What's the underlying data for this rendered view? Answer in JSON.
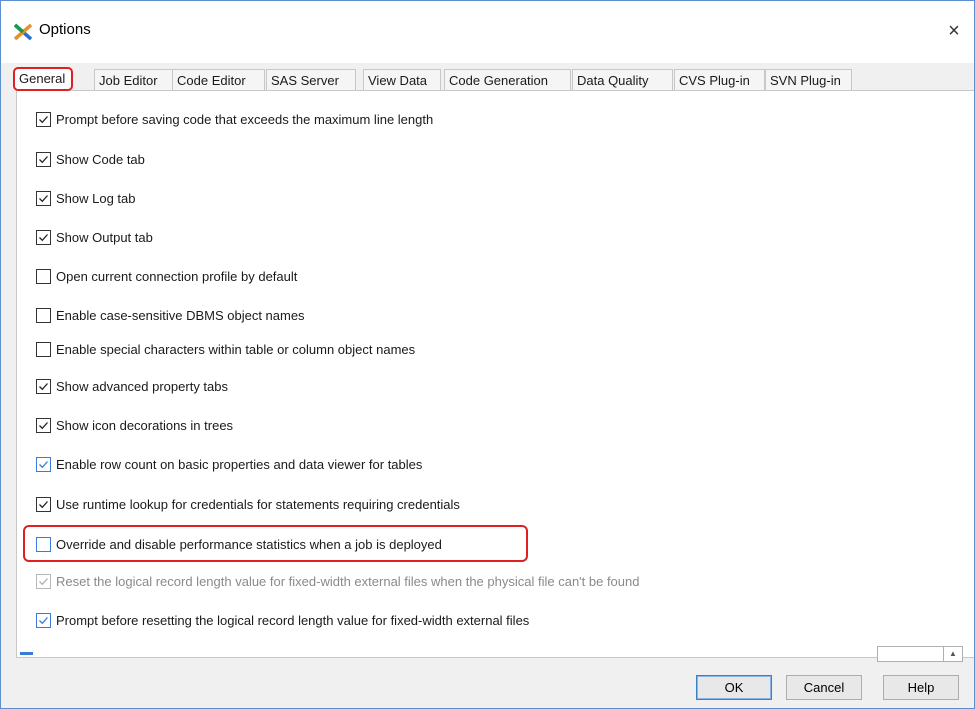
{
  "window": {
    "title": "Options",
    "close_glyph": "×"
  },
  "tabs": [
    {
      "label": "General",
      "active": true
    },
    {
      "label": "Job Editor",
      "active": false
    },
    {
      "label": "Code Editor",
      "active": false
    },
    {
      "label": "SAS Server",
      "active": false
    },
    {
      "label": "View Data",
      "active": false
    },
    {
      "label": "Code Generation",
      "active": false
    },
    {
      "label": "Data Quality",
      "active": false
    },
    {
      "label": "CVS Plug-in",
      "active": false
    },
    {
      "label": "SVN Plug-in",
      "active": false
    }
  ],
  "options": [
    {
      "label": "Prompt before saving code that exceeds the maximum line length",
      "checked": true,
      "enabled": true
    },
    {
      "label": "Show Code tab",
      "checked": true,
      "enabled": true
    },
    {
      "label": "Show Log tab",
      "checked": true,
      "enabled": true
    },
    {
      "label": "Show Output tab",
      "checked": true,
      "enabled": true
    },
    {
      "label": "Open current connection profile by default",
      "checked": false,
      "enabled": true
    },
    {
      "label": "Enable case-sensitive DBMS object names",
      "checked": false,
      "enabled": true
    },
    {
      "label": "Enable special characters within table or column object names",
      "checked": false,
      "enabled": true
    },
    {
      "label": "Show advanced property tabs",
      "checked": true,
      "enabled": true
    },
    {
      "label": "Show icon decorations in trees",
      "checked": true,
      "enabled": true
    },
    {
      "label": "Enable row count on basic properties and data viewer for tables",
      "checked": true,
      "enabled": true
    },
    {
      "label": "Use runtime lookup for credentials for statements requiring credentials",
      "checked": true,
      "enabled": true
    },
    {
      "label": "Override and disable performance statistics when a job is deployed",
      "checked": false,
      "enabled": true
    },
    {
      "label": "Reset the logical record length value for fixed-width external files when the physical file can't be found",
      "checked": true,
      "enabled": false
    },
    {
      "label": "Prompt before resetting the logical record length value for fixed-width external files",
      "checked": true,
      "enabled": true
    }
  ],
  "buttons": {
    "ok": "OK",
    "cancel": "Cancel",
    "help": "Help"
  },
  "colors": {
    "highlight": "#e02020",
    "accent": "#3a7bd5"
  }
}
